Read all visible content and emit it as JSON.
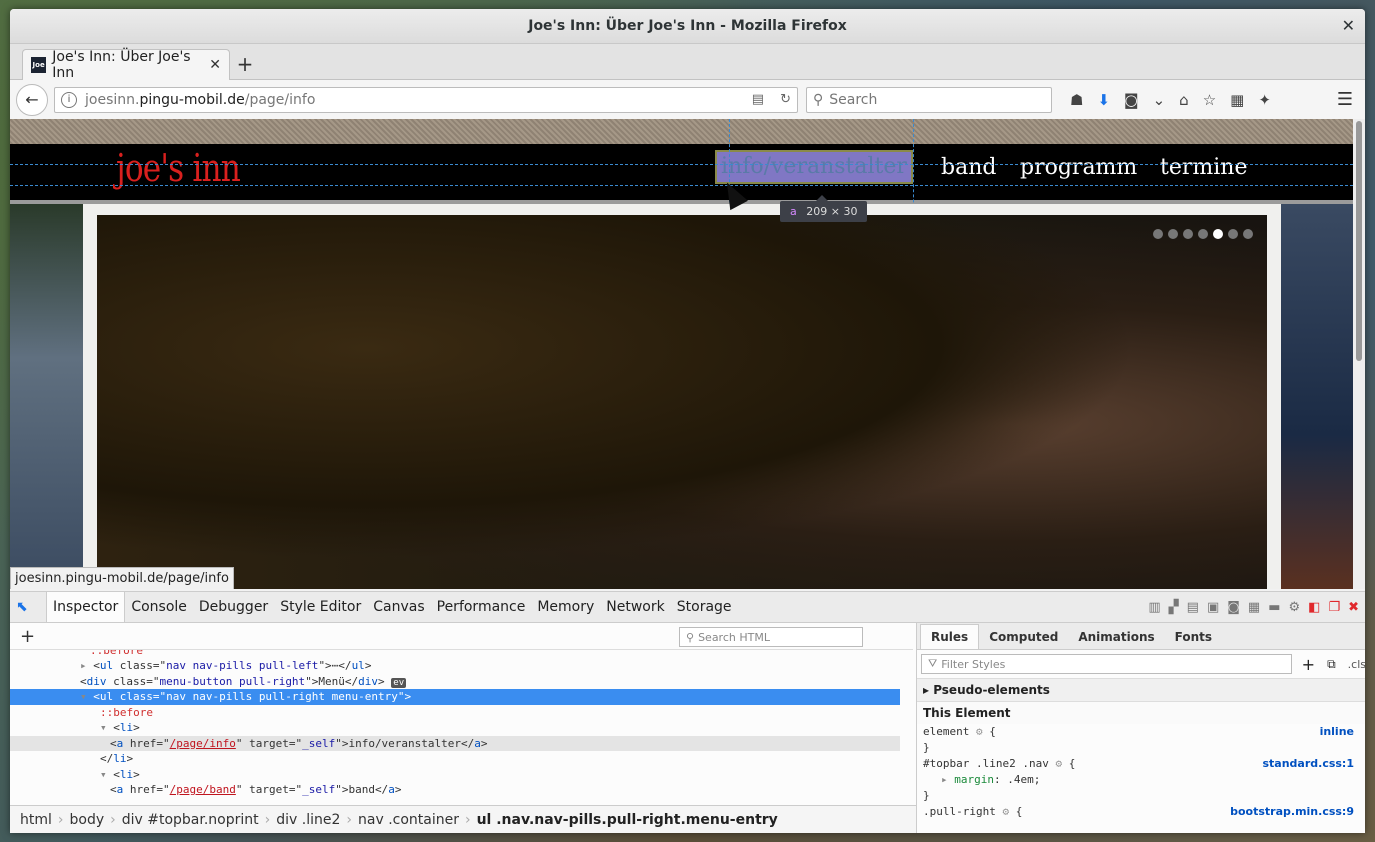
{
  "window": {
    "title": "Joe's Inn: Über Joe's Inn - Mozilla Firefox"
  },
  "tabs": [
    {
      "favicon_text": "Joe",
      "label": "Joe's Inn: Über Joe's Inn"
    }
  ],
  "navbar": {
    "url_prefix": "joesinn.",
    "url_host": "pingu-mobil.de",
    "url_path": "/page/info",
    "search_placeholder": "Search"
  },
  "page": {
    "logo": "joe's inn",
    "menu": [
      "info/veranstalter",
      "band",
      "programm",
      "termine"
    ],
    "tooltip_tag": "a",
    "tooltip_size": "209 × 30",
    "slider_dots": 7,
    "slider_active_index": 4,
    "status_link": "joesinn.pingu-mobil.de/page/info"
  },
  "devtools": {
    "tabs": [
      "Inspector",
      "Console",
      "Debugger",
      "Style Editor",
      "Canvas",
      "Performance",
      "Memory",
      "Network",
      "Storage"
    ],
    "search_html_placeholder": "Search HTML",
    "markup": [
      {
        "text": "::before",
        "kind": "pseudo",
        "indent": 8,
        "hidden_top": true
      },
      {
        "text": "<ul class=\"nav nav-pills pull-left\">⋯</ul>",
        "kind": "node",
        "indent": 7
      },
      {
        "text": "<div class=\"menu-button pull-right\">Menü</div>",
        "kind": "node",
        "indent": 7,
        "ev": true
      },
      {
        "text": "<ul class=\"nav nav-pills pull-right menu-entry\">",
        "kind": "node",
        "indent": 7,
        "selected": true
      },
      {
        "text": "::before",
        "kind": "pseudo",
        "indent": 9
      },
      {
        "text": "<li>",
        "kind": "node",
        "indent": 9
      },
      {
        "text": "<a href=\"/page/info\" target=\"_self\">info/veranstalter</a>",
        "kind": "node",
        "indent": 10,
        "hover": true
      },
      {
        "text": "</li>",
        "kind": "node",
        "indent": 9
      },
      {
        "text": "<li>",
        "kind": "node",
        "indent": 9
      },
      {
        "text": "<a href=\"/page/band\" target=\"_self\">band</a>",
        "kind": "node",
        "indent": 10
      }
    ],
    "breadcrumbs": [
      "html",
      "body",
      "div #topbar.noprint",
      "div .line2",
      "nav .container",
      "ul .nav.nav-pills.pull-right.menu-entry"
    ],
    "side_tabs": [
      "Rules",
      "Computed",
      "Animations",
      "Fonts"
    ],
    "filter_placeholder": "Filter Styles",
    "cls_label": ".cls",
    "pseudo_elements": "Pseudo-elements",
    "this_element": "This Element",
    "rules": [
      {
        "selector": "element",
        "source": "inline",
        "body": []
      },
      {
        "selector": "#topbar .line2 .nav",
        "source": "standard.css:1",
        "body": [
          "margin: .4em;"
        ]
      },
      {
        "selector": ".pull-right",
        "source": "bootstrap.min.css:9",
        "body": []
      }
    ]
  }
}
